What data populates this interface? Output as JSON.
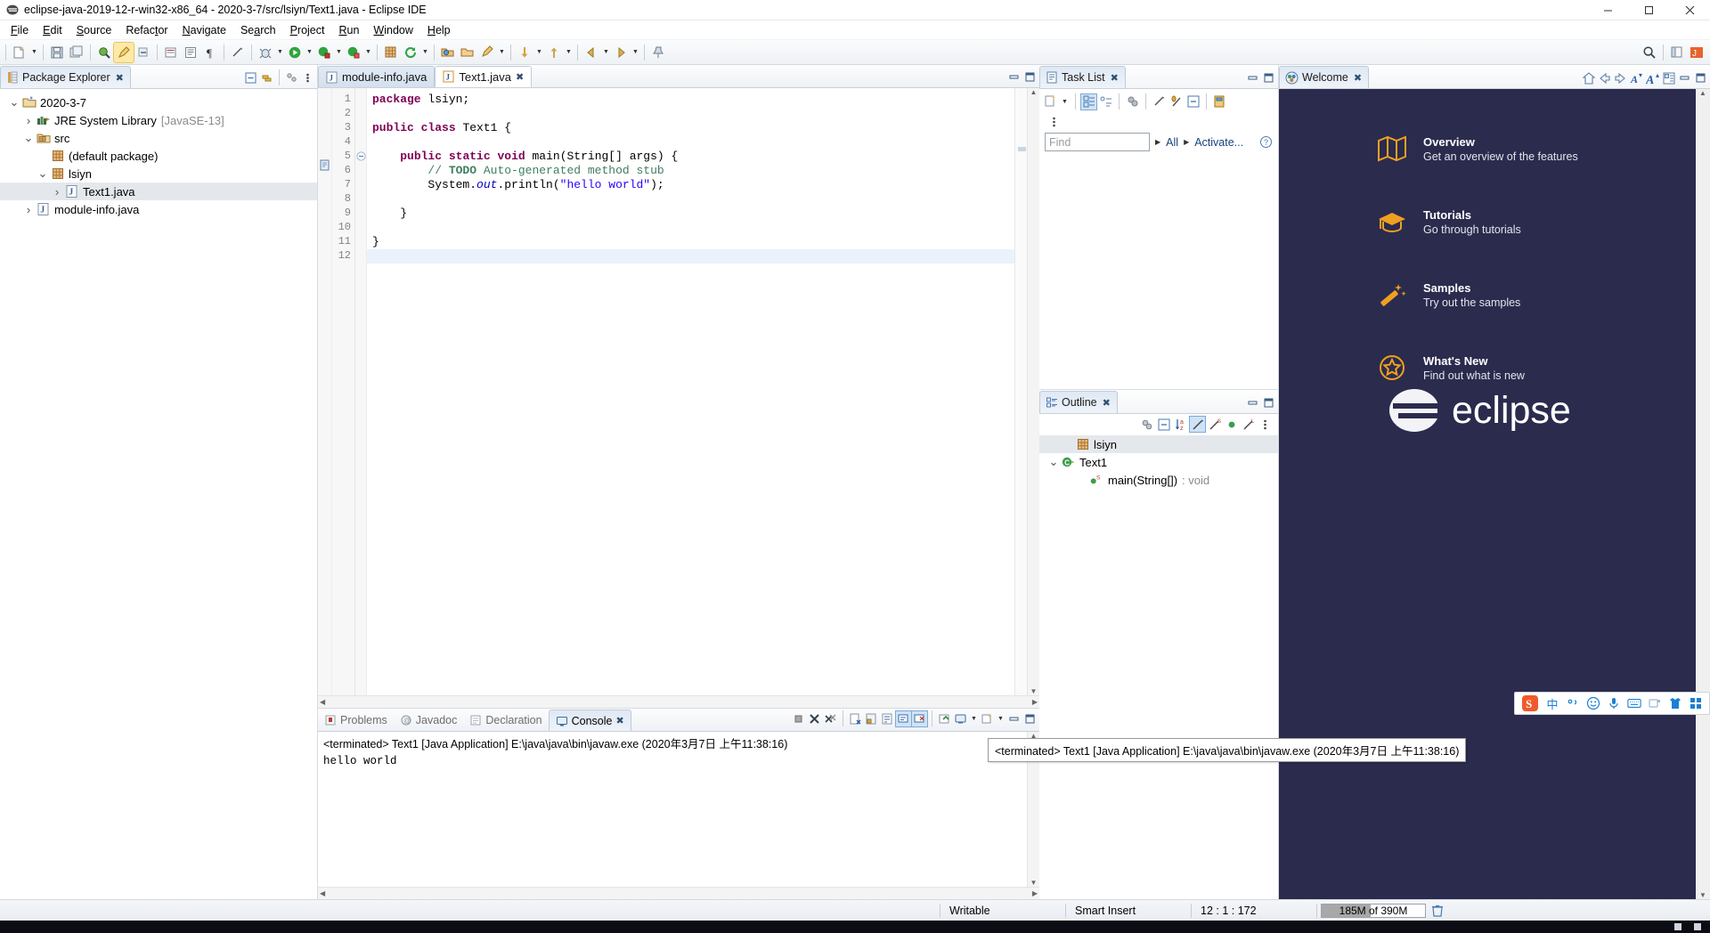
{
  "window": {
    "title": "eclipse-java-2019-12-r-win32-x86_64 - 2020-3-7/src/lsiyn/Text1.java - Eclipse IDE",
    "minimize": "—",
    "maximize": "❐",
    "close": "✕"
  },
  "menu": [
    "File",
    "Edit",
    "Source",
    "Refactor",
    "Navigate",
    "Search",
    "Project",
    "Run",
    "Window",
    "Help"
  ],
  "package_explorer": {
    "title": "Package Explorer",
    "close_glyph": "✖",
    "tree": [
      {
        "label": "2020-3-7",
        "sub": "",
        "indent": 0,
        "twist": "open",
        "icon": "project-icon",
        "selected": false
      },
      {
        "label": "JRE System Library",
        "sub": "[JavaSE-13]",
        "indent": 1,
        "twist": "closed",
        "icon": "library-icon",
        "selected": false
      },
      {
        "label": "src",
        "sub": "",
        "indent": 1,
        "twist": "open",
        "icon": "source-folder-icon",
        "selected": false
      },
      {
        "label": "(default package)",
        "sub": "",
        "indent": 2,
        "twist": "none",
        "icon": "package-icon",
        "selected": false
      },
      {
        "label": "lsiyn",
        "sub": "",
        "indent": 2,
        "twist": "open",
        "icon": "package-icon",
        "selected": false
      },
      {
        "label": "Text1.java",
        "sub": "",
        "indent": 3,
        "twist": "closed",
        "icon": "java-file-icon",
        "selected": true
      },
      {
        "label": "module-info.java",
        "sub": "",
        "indent": 1,
        "twist": "closed",
        "icon": "java-file-icon",
        "selected": false
      }
    ]
  },
  "editor": {
    "tabs": [
      {
        "label": "module-info.java",
        "active": false,
        "close": ""
      },
      {
        "label": "Text1.java",
        "active": true,
        "close": "✖"
      }
    ],
    "lines": [
      {
        "n": "1",
        "html": "package lsiyn;",
        "folding": "",
        "current": false
      },
      {
        "n": "2",
        "html": "",
        "folding": "",
        "current": false
      },
      {
        "n": "3",
        "html": "public class Text1 {",
        "folding": "",
        "current": false
      },
      {
        "n": "4",
        "html": "",
        "folding": "",
        "current": false
      },
      {
        "n": "5",
        "html": "    public static void main(String[] args) {",
        "folding": "minus",
        "current": false
      },
      {
        "n": "6",
        "html": "        // TODO Auto-generated method stub",
        "folding": "",
        "current": false
      },
      {
        "n": "7",
        "html": "        System.out.println(\"hello world\");",
        "folding": "",
        "current": false
      },
      {
        "n": "8",
        "html": "",
        "folding": "",
        "current": false
      },
      {
        "n": "9",
        "html": "    }",
        "folding": "",
        "current": false
      },
      {
        "n": "10",
        "html": "",
        "folding": "",
        "current": false
      },
      {
        "n": "11",
        "html": "}",
        "folding": "",
        "current": false
      },
      {
        "n": "12",
        "html": "",
        "folding": "",
        "current": true
      }
    ]
  },
  "console": {
    "tabs": [
      {
        "label": "Problems",
        "selected": false,
        "icon": "problems-icon"
      },
      {
        "label": "Javadoc",
        "selected": false,
        "icon": "javadoc-icon"
      },
      {
        "label": "Declaration",
        "selected": false,
        "icon": "declaration-icon"
      },
      {
        "label": "Console",
        "selected": true,
        "icon": "console-icon"
      }
    ],
    "terminated_line": "<terminated> Text1 [Java Application] E:\\java\\java\\bin\\javaw.exe (2020年3月7日 上午11:38:16)",
    "output": "hello world"
  },
  "tooltip": {
    "text": "<terminated> Text1 [Java Application] E:\\java\\java\\bin\\javaw.exe (2020年3月7日 上午11:38:16)"
  },
  "task_list": {
    "title": "Task List",
    "close_glyph": "✖",
    "find_placeholder": "Find",
    "all_label": "All",
    "activate_label": "Activate...",
    "help_glyph": "?"
  },
  "outline": {
    "title": "Outline",
    "close_glyph": "✖",
    "tree": [
      {
        "label": "lsiyn",
        "sub": "",
        "indent": 1,
        "twist": "none",
        "icon": "package-icon",
        "selected": true
      },
      {
        "label": "Text1",
        "sub": "",
        "indent": 0,
        "twist": "open",
        "icon": "class-icon",
        "selected": false
      },
      {
        "label": "main(String[])",
        "sub": ": void",
        "indent": 2,
        "twist": "none",
        "icon": "method-public-static-icon",
        "selected": false
      }
    ]
  },
  "welcome": {
    "title": "Welcome",
    "close_glyph": "✖",
    "items": [
      {
        "title": "Overview",
        "sub": "Get an overview of the features",
        "icon": "map-icon"
      },
      {
        "title": "Tutorials",
        "sub": "Go through tutorials",
        "icon": "graduation-cap-icon"
      },
      {
        "title": "Samples",
        "sub": "Try out the samples",
        "icon": "magic-wand-icon"
      },
      {
        "title": "What's New",
        "sub": "Find out what is new",
        "icon": "star-burst-icon"
      }
    ],
    "logo_text": "eclipse"
  },
  "status_bar": {
    "writable": "Writable",
    "insert_mode": "Smart Insert",
    "position": "12 : 1 : 172",
    "heap": "185M of 390M",
    "heap_percent": 47
  },
  "ime": {
    "lang": "中",
    "items": [
      "sogou-logo",
      "chinese-mode",
      "punctuation",
      "emoji",
      "microphone",
      "keyboard",
      "clipboard",
      "skin",
      "apps"
    ]
  },
  "colors": {
    "accent": "#1b7fd4",
    "welcome_bg": "#2b2b4e",
    "welcome_icon": "#f0a020",
    "keyword": "#7f0055",
    "string": "#2a00ff",
    "comment": "#3f7f5f",
    "field": "#0000c0",
    "link": "#16417f"
  }
}
